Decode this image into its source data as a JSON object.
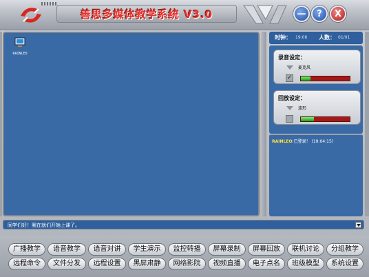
{
  "app": {
    "title": "善思多媒体教学系统 V3.0",
    "accent_color": "#3a6aa5",
    "title_color": "#e4322c"
  },
  "window_controls": {
    "minimize_label": "—",
    "help_label": "?",
    "close_label": "X"
  },
  "desktop": {
    "student": {
      "name": "RAINLEO",
      "icon": "computer-icon"
    }
  },
  "status": {
    "clock_label": "时钟：",
    "clock_value": "19:06",
    "count_label": "人数：",
    "count_value": "01/01"
  },
  "record": {
    "title": "录音设定：",
    "device": "麦克风",
    "checked": true,
    "level": 0.2
  },
  "playback": {
    "title": "回放设定：",
    "device": "波形",
    "checked": false,
    "level": 0.27
  },
  "log": {
    "user": "RAINLEO",
    "message": ":已登录！ (19:04:15)"
  },
  "message_bar": {
    "text": "同学们好！我在就们开始上课了。"
  },
  "buttons_row1": [
    "广播教学",
    "语音教学",
    "语音对讲",
    "学生演示",
    "监控转播",
    "屏幕录制",
    "屏幕回放",
    "联机讨论",
    "分组教学"
  ],
  "buttons_row2": [
    "远程命令",
    "文件分发",
    "远程设置",
    "黑屏肃静",
    "网络影院",
    "视频直播",
    "电子点名",
    "班级模型",
    "系统设置"
  ]
}
